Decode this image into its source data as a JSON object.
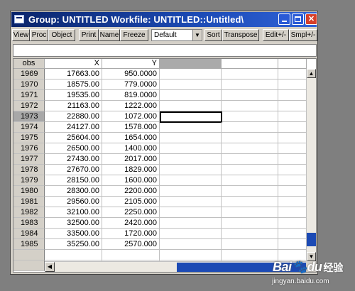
{
  "window": {
    "title": "Group: UNTITLED    Workfile: UNTITLED::Untitled\\"
  },
  "toolbar": {
    "buttons": [
      "View",
      "Proc",
      "Object",
      "Print",
      "Name",
      "Freeze",
      "Sort",
      "Transpose",
      "Edit+/-",
      "Smpl+/-"
    ],
    "display_select": "Default"
  },
  "grid": {
    "headers": {
      "obs": "obs",
      "x": "X",
      "y": "Y"
    },
    "selected_obs": "1973",
    "rows": [
      {
        "obs": "1969",
        "x": "17663.00",
        "y": "950.0000"
      },
      {
        "obs": "1970",
        "x": "18575.00",
        "y": "779.0000"
      },
      {
        "obs": "1971",
        "x": "19535.00",
        "y": "819.0000"
      },
      {
        "obs": "1972",
        "x": "21163.00",
        "y": "1222.000"
      },
      {
        "obs": "1973",
        "x": "22880.00",
        "y": "1072.000"
      },
      {
        "obs": "1974",
        "x": "24127.00",
        "y": "1578.000"
      },
      {
        "obs": "1975",
        "x": "25604.00",
        "y": "1654.000"
      },
      {
        "obs": "1976",
        "x": "26500.00",
        "y": "1400.000"
      },
      {
        "obs": "1977",
        "x": "27430.00",
        "y": "2017.000"
      },
      {
        "obs": "1978",
        "x": "27670.00",
        "y": "1829.000"
      },
      {
        "obs": "1979",
        "x": "28150.00",
        "y": "1600.000"
      },
      {
        "obs": "1980",
        "x": "28300.00",
        "y": "2200.000"
      },
      {
        "obs": "1981",
        "x": "29560.00",
        "y": "2105.000"
      },
      {
        "obs": "1982",
        "x": "32100.00",
        "y": "2250.000"
      },
      {
        "obs": "1983",
        "x": "32500.00",
        "y": "2420.000"
      },
      {
        "obs": "1984",
        "x": "33500.00",
        "y": "1720.000"
      },
      {
        "obs": "1985",
        "x": "35250.00",
        "y": "2570.000"
      }
    ]
  },
  "watermark": {
    "logo_bai": "Bai",
    "logo_du": "du",
    "logo_jingyan": "经验",
    "url": "jingyan.baidu.com"
  }
}
